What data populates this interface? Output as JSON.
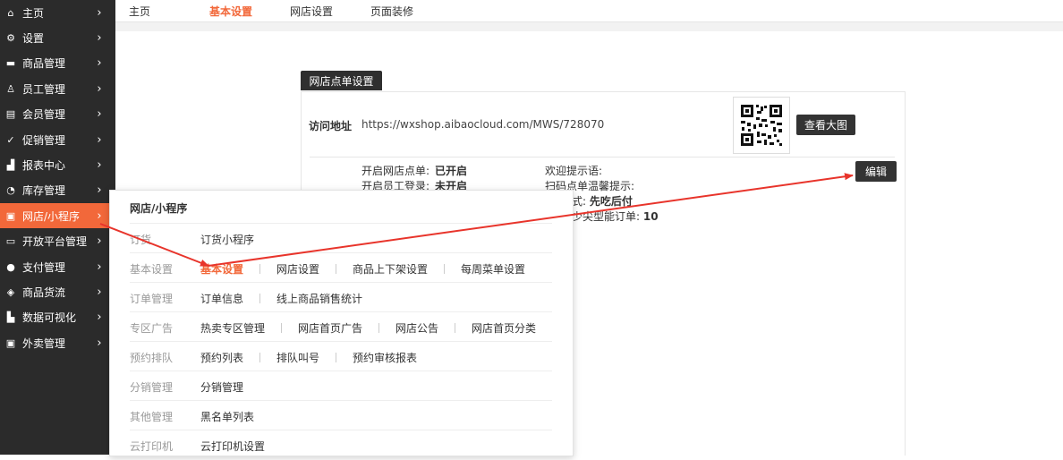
{
  "sidebar": {
    "items": [
      {
        "label": "主页",
        "icon": "home-icon",
        "glyph": "⌂"
      },
      {
        "label": "设置",
        "icon": "gear-icon",
        "glyph": "⚙"
      },
      {
        "label": "商品管理",
        "icon": "goods-icon",
        "glyph": "▬"
      },
      {
        "label": "员工管理",
        "icon": "staff-icon",
        "glyph": "♙"
      },
      {
        "label": "会员管理",
        "icon": "member-icon",
        "glyph": "▤"
      },
      {
        "label": "促销管理",
        "icon": "promotion-icon",
        "glyph": "✓"
      },
      {
        "label": "报表中心",
        "icon": "report-icon",
        "glyph": "▟"
      },
      {
        "label": "库存管理",
        "icon": "stock-icon",
        "glyph": "◔"
      },
      {
        "label": "网店/小程序",
        "icon": "shop-icon",
        "glyph": "▣"
      },
      {
        "label": "开放平台管理",
        "icon": "monitor-icon",
        "glyph": "▭"
      },
      {
        "label": "支付管理",
        "icon": "payment-icon",
        "glyph": "●"
      },
      {
        "label": "商品货流",
        "icon": "logistics-icon",
        "glyph": "◈"
      },
      {
        "label": "数据可视化",
        "icon": "chart-icon",
        "glyph": "▙"
      },
      {
        "label": "外卖管理",
        "icon": "takeout-icon",
        "glyph": "▣"
      }
    ],
    "chevron": "›"
  },
  "tabs": [
    "主页",
    "基本设置",
    "网店设置",
    "页面装修"
  ],
  "panel": {
    "tab_label": "网店点单设置",
    "url_label": "访问地址",
    "url_value": "https://wxshop.aibaocloud.com/MWS/728070",
    "view_qr_button": "查看大图",
    "edit_button": "编辑",
    "left_settings": [
      {
        "label": "开启网店点单:",
        "value": "已开启"
      },
      {
        "label": "开启员工登录:",
        "value": "未开启"
      }
    ],
    "right_settings": [
      {
        "label": "欢迎提示语:",
        "value": ""
      },
      {
        "label": "扫码点单温馨提示:",
        "value": ""
      }
    ],
    "partial_line_1": "式: ",
    "partial_line_1_value": "先吃后付",
    "partial_line_2": "少尖型能订单: ",
    "partial_line_2_value": "10"
  },
  "menu": {
    "title": "网店/小程序",
    "rows": [
      {
        "category": "订货",
        "links": [
          "订货小程序"
        ]
      },
      {
        "category": "基本设置",
        "links": [
          "基本设置",
          "网店设置",
          "商品上下架设置",
          "每周菜单设置"
        ]
      },
      {
        "category": "订单管理",
        "links": [
          "订单信息",
          "线上商品销售统计"
        ]
      },
      {
        "category": "专区广告",
        "links": [
          "热卖专区管理",
          "网店首页广告",
          "网店公告",
          "网店首页分类"
        ]
      },
      {
        "category": "预约排队",
        "links": [
          "预约列表",
          "排队叫号",
          "预约审核报表"
        ]
      },
      {
        "category": "分销管理",
        "links": [
          "分销管理"
        ]
      },
      {
        "category": "其他管理",
        "links": [
          "黑名单列表"
        ]
      },
      {
        "category": "云打印机",
        "links": [
          "云打印机设置"
        ]
      }
    ]
  },
  "colors": {
    "accent": "#f2683a",
    "annotation_arrow": "#e8342b",
    "sidebar_bg": "#2b2b2b"
  }
}
